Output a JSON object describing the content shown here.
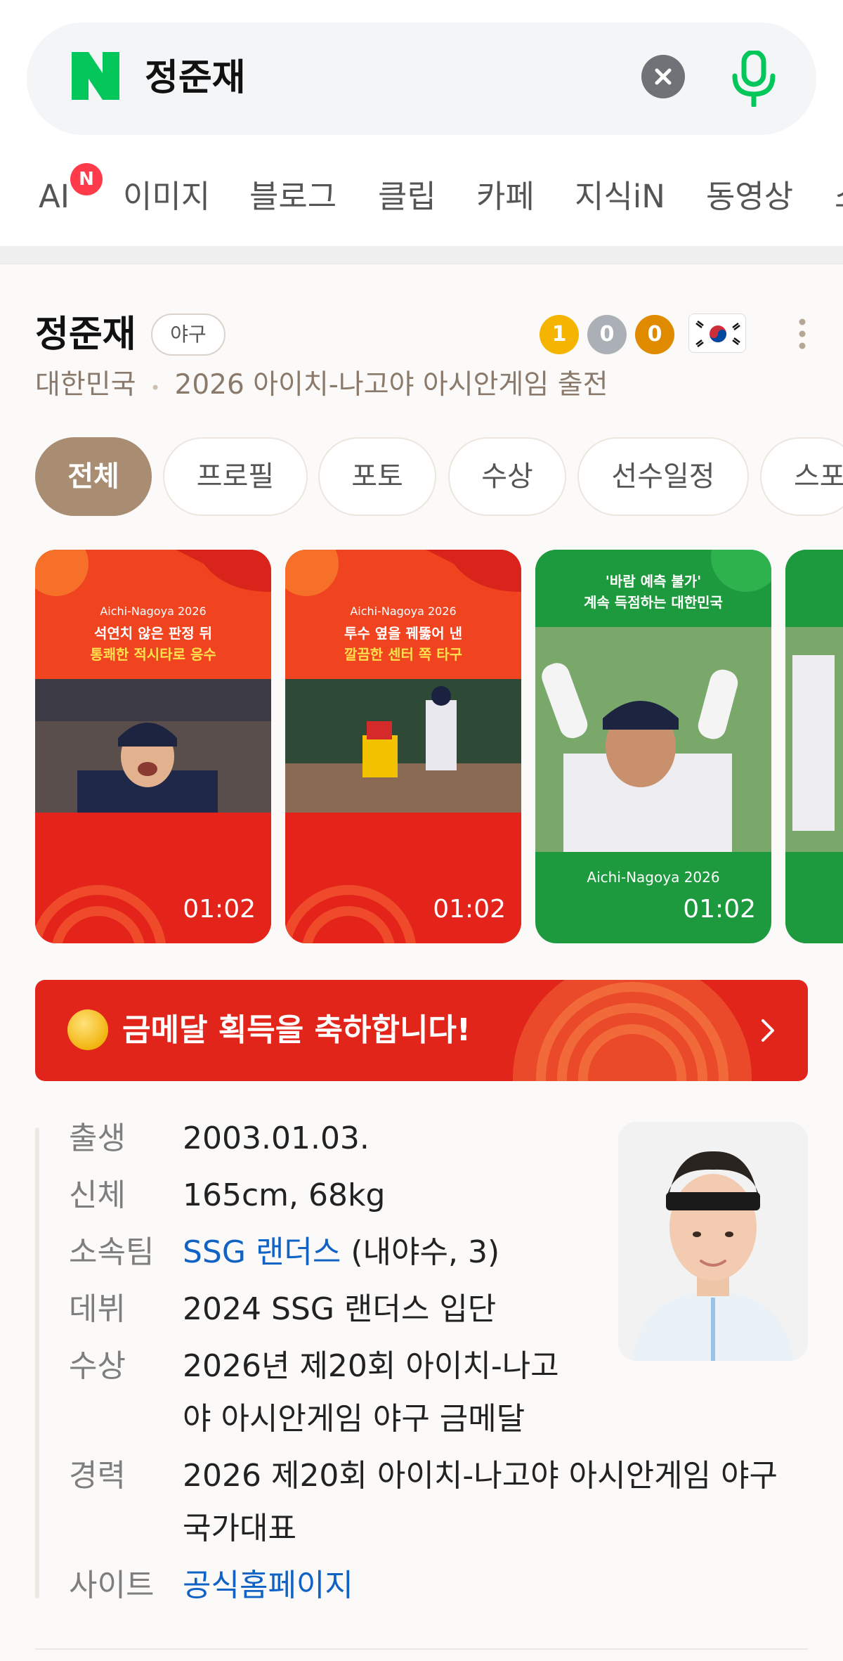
{
  "search": {
    "query": "정준재"
  },
  "tabs": [
    {
      "label": "AI",
      "badge": "N"
    },
    {
      "label": "이미지"
    },
    {
      "label": "블로그"
    },
    {
      "label": "클립"
    },
    {
      "label": "카페"
    },
    {
      "label": "지식iN"
    },
    {
      "label": "동영상"
    },
    {
      "label": "쇼"
    }
  ],
  "profile": {
    "name": "정준재",
    "sport": "야구",
    "medals": {
      "gold": "1",
      "silver": "0",
      "bronze": "0"
    },
    "nationality": "대한민국",
    "separator": "•",
    "event": "2026 아이치-나고야 아시안게임 출전"
  },
  "pills": [
    "전체",
    "프로필",
    "포토",
    "수상",
    "선수일정",
    "스포"
  ],
  "videos": [
    {
      "event": "Aichi-Nagoya 2026",
      "line1": "석연치 않은 판정 뒤",
      "line2": "통쾌한 적시타로 응수",
      "duration": "01:02"
    },
    {
      "event": "Aichi-Nagoya 2026",
      "line1": "투수 옆을 꿰뚫어 낸",
      "line2": "깔끔한 센터 쪽 타구",
      "duration": "01:02"
    },
    {
      "event": "Aichi-Nagoya 2026",
      "line1": "'바람 예측 불가'",
      "line2": "계속 득점하는 대한민국",
      "duration": "01:02"
    }
  ],
  "banner": {
    "text": "금메달 획득을 축하합니다!"
  },
  "info": {
    "born_label": "출생",
    "born": "2003.01.03.",
    "body_label": "신체",
    "body": "165cm, 68kg",
    "team_label": "소속팀",
    "team_link": "SSG 랜더스",
    "team_detail": "(내야수, 3)",
    "debut_label": "데뷔",
    "debut": "2024 SSG 랜더스 입단",
    "award_label": "수상",
    "award_line1": "2026년 제20회 아이치-나고",
    "award_line2": "야 아시안게임 야구 금메달",
    "career_label": "경력",
    "career_line1": "2026 제20회 아이치-나고야 아시안게임 야구",
    "career_line2": "국가대표",
    "site_label": "사이트",
    "site_link": "공식홈페이지"
  },
  "colors": {
    "naver_green": "#03c75a",
    "accent_brown": "#a88d73",
    "link_blue": "#1062c5",
    "banner_red": "#e1251b",
    "gold": "#f5b400",
    "silver": "#aab0b6",
    "bronze": "#e08a00"
  }
}
